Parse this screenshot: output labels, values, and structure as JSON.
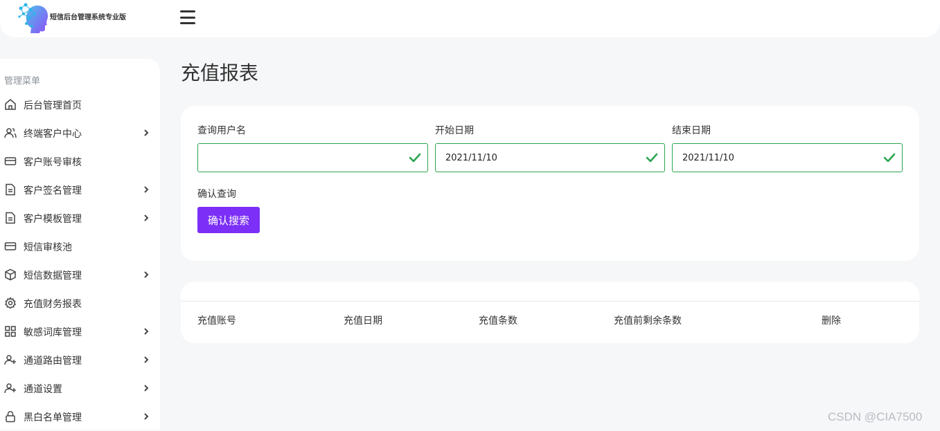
{
  "header": {
    "brand": "短信后台管理系统专业版"
  },
  "sidebar": {
    "heading": "管理菜单",
    "items": [
      {
        "label": "后台管理首页"
      },
      {
        "label": "终端客户中心"
      },
      {
        "label": "客户账号审核"
      },
      {
        "label": "客户签名管理"
      },
      {
        "label": "客户模板管理"
      },
      {
        "label": "短信审核池"
      },
      {
        "label": "短信数据管理"
      },
      {
        "label": "充值财务报表"
      },
      {
        "label": "敏感词库管理"
      },
      {
        "label": "通道路由管理"
      },
      {
        "label": "通道设置"
      },
      {
        "label": "黑白名单管理"
      }
    ]
  },
  "page": {
    "title": "充值报表"
  },
  "search": {
    "username_label": "查询用户名",
    "username_value": "",
    "start_label": "开始日期",
    "start_value": "2021/11/10",
    "end_label": "结束日期",
    "end_value": "2021/11/10",
    "confirm_label": "确认查询",
    "confirm_button": "确认搜索"
  },
  "table": {
    "columns": [
      "充值账号",
      "充值日期",
      "充值条数",
      "充值前剩余条数",
      "删除"
    ]
  },
  "watermark": "CSDN @CIA7500",
  "colors": {
    "accent": "#7b2ff7",
    "valid": "#2aa44f",
    "background": "#f6f7f9"
  }
}
